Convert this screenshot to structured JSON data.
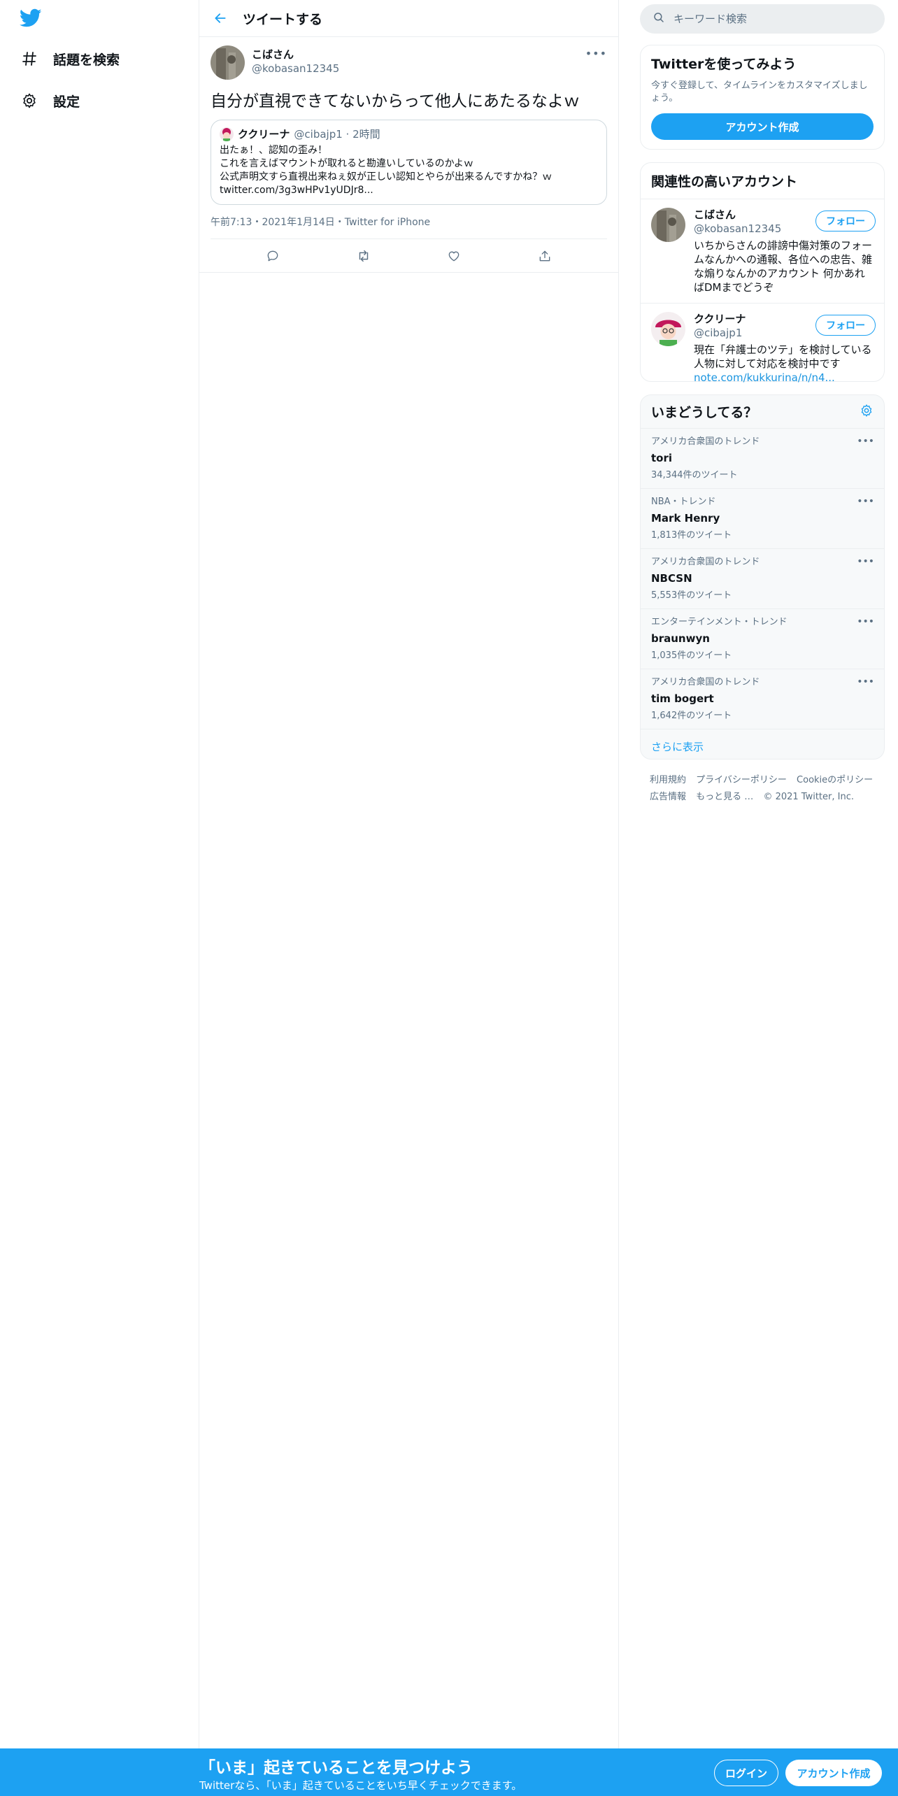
{
  "nav": {
    "explore_label": "話題を検索",
    "settings_label": "設定"
  },
  "header": {
    "title": "ツイートする"
  },
  "tweet": {
    "author_name": "こばさん",
    "author_handle": "@kobasan12345",
    "text": "自分が直視できてないからって他人にあたるなよｗ",
    "quote": {
      "author_name": "ククリーナ",
      "author_handle": "@cibajp1 · 2時間",
      "body": "出たぁ！、認知の歪み！\nこれを言えばマウントが取れると勘違いしているのかよｗ\n公式声明文すら直視出来ねぇ奴が正しい認知とやらが出来るんですかね？ｗ\ntwitter.com/3g3wHPv1yUDJr8..."
    },
    "meta": "午前7:13・2021年1月14日・Twitter for iPhone"
  },
  "search": {
    "placeholder": "キーワード検索"
  },
  "signup_card": {
    "title": "Twitterを使ってみよう",
    "subtitle": "今すぐ登録して、タイムラインをカスタマイズしましょう。",
    "button": "アカウント作成"
  },
  "related": {
    "title": "関連性の高いアカウント",
    "follow_label": "フォロー",
    "accounts": [
      {
        "name": "こばさん",
        "handle": "@kobasan12345",
        "bio": "いちからさんの誹謗中傷対策のフォームなんかへの通報、各位への忠告、雑な煽りなんかのアカウント 何かあればDMまでどうぞ",
        "link": ""
      },
      {
        "name": "ククリーナ",
        "handle": "@cibajp1",
        "bio": "現在「弁護士のツテ」を検討している人物に対して対応を検討中です",
        "link": "note.com/kukkurina/n/n4..."
      }
    ]
  },
  "trends": {
    "title": "いまどうしてる？",
    "items": [
      {
        "context": "アメリカ合衆国のトレンド",
        "name": "tori",
        "count": "34,344件のツイート"
      },
      {
        "context": "NBA・トレンド",
        "name": "Mark Henry",
        "count": "1,813件のツイート"
      },
      {
        "context": "アメリカ合衆国のトレンド",
        "name": "NBCSN",
        "count": "5,553件のツイート"
      },
      {
        "context": "エンターテインメント・トレンド",
        "name": "braunwyn",
        "count": "1,035件のツイート"
      },
      {
        "context": "アメリカ合衆国のトレンド",
        "name": "tim bogert",
        "count": "1,642件のツイート"
      }
    ],
    "show_more": "さらに表示"
  },
  "footer": {
    "terms": "利用規約",
    "privacy": "プライバシーポリシー",
    "cookie": "Cookieのポリシー",
    "ads": "広告情報",
    "more": "もっと見る …",
    "copyright": "© 2021 Twitter, Inc."
  },
  "bottom_bar": {
    "title": "「いま」起きていることを見つけよう",
    "subtitle": "Twitterなら、「いま」起きていることをいち早くチェックできます。",
    "login": "ログイン",
    "signup": "アカウント作成"
  },
  "colors": {
    "accent": "#1da1f2",
    "text": "#0f1419",
    "secondary": "#5b7083",
    "border": "#ebeef0"
  }
}
